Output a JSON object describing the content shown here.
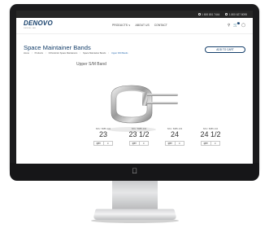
{
  "top_bar": {
    "phone_1": "1 800 851 7444",
    "phone_2": "1 800 627 8095"
  },
  "nav": {
    "logo": "DENOVO",
    "logo_sub": "DENTAL LAB",
    "links": [
      "PRODUCTS ∨",
      "ABOUT US",
      "CONTACT"
    ],
    "search_icon": "search-icon",
    "cart_icon": "cart-icon",
    "cart_count": "0",
    "user_icon": "user-icon"
  },
  "page": {
    "title": "Space Maintainer Bands",
    "breadcrumb": [
      "Home",
      "Products",
      "Orthodontic Space Maintainers",
      "Space Maintainer Bands",
      "Upper S/M Bands"
    ],
    "add_to_cart": "ADD TO CART",
    "section_title": "Upper S/M Band"
  },
  "sizes": [
    {
      "sku": "SKU: 8385-131",
      "size": "23",
      "qty_label": "QTY",
      "qty": "0"
    },
    {
      "sku": "SKU: 8385-132",
      "size": "23 1/2",
      "qty_label": "QTY",
      "qty": "0"
    },
    {
      "sku": "SKU: 8385-133",
      "size": "24",
      "qty_label": "QTY",
      "qty": "0"
    },
    {
      "sku": "SKU: 8385-134",
      "size": "24 1/2",
      "qty_label": "QTY",
      "qty": "0"
    }
  ],
  "device": {
    "apple_icon": "apple-logo-icon"
  },
  "colors": {
    "brand": "#153f6b",
    "topbar": "#262626",
    "link": "#2b6cb0"
  }
}
